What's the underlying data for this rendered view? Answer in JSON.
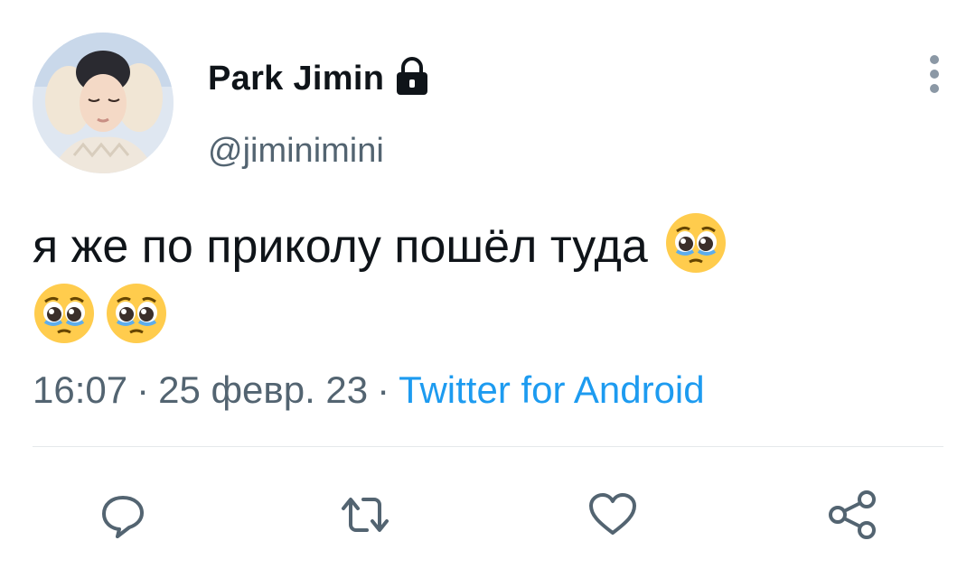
{
  "user": {
    "display_name": "Park Jimin",
    "handle": "@jiminimini",
    "protected": true,
    "avatar_icon": "avatar-photo"
  },
  "tweet": {
    "text": "я же по приколу пошёл туда",
    "emojis": [
      "pleading-face-emoji",
      "pleading-face-emoji",
      "pleading-face-emoji"
    ]
  },
  "meta": {
    "time": "16:07",
    "date": "25 февр. 23",
    "separator": "·",
    "source": "Twitter for Android"
  },
  "actions": [
    {
      "name": "reply",
      "icon": "reply-icon"
    },
    {
      "name": "retweet",
      "icon": "retweet-icon"
    },
    {
      "name": "like",
      "icon": "heart-icon"
    },
    {
      "name": "share",
      "icon": "share-icon"
    }
  ],
  "colors": {
    "text": "#0f1419",
    "secondary": "#536471",
    "accent": "#1d9bf0",
    "icon": "#536471"
  }
}
